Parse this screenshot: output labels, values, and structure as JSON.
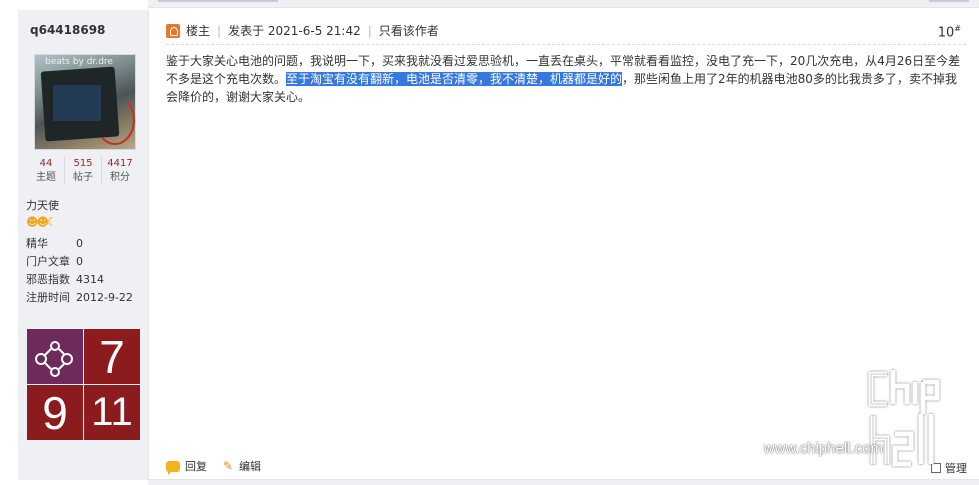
{
  "sidebar": {
    "username": "q64418698",
    "avatar_brand": "beats by dr.dre",
    "stats": [
      {
        "num": "44",
        "label": "主题"
      },
      {
        "num": "515",
        "label": "帖子"
      },
      {
        "num": "4417",
        "label": "积分"
      }
    ],
    "rank": "力天使",
    "star_icons": [
      "sun-icon",
      "sun-icon",
      "moon-icon"
    ],
    "info": [
      {
        "key": "精华",
        "value": "0"
      },
      {
        "key": "门户文章",
        "value": "0"
      },
      {
        "key": "邪恶指数",
        "value": "4314"
      },
      {
        "key": "注册时间",
        "value": "2012-9-22"
      }
    ],
    "medals": [
      "",
      "7",
      "9",
      "11"
    ]
  },
  "post": {
    "author_role": "楼主",
    "posted_at": "发表于 2021-6-5 21:42",
    "only_author": "只看该作者",
    "floor": "10",
    "floor_suffix": "#",
    "content_before": "鉴于大家关心电池的问题，我说明一下，买来我就没看过爱思验机，一直丢在桌头，平常就看看监控，没电了充一下，20几次充电，从4月26日至今差不多是这个充电次数。",
    "content_highlight": "至于淘宝有没有翻新，电池是否清零，我不清楚，机器都是好的",
    "content_after": "，那些闲鱼上用了2年的机器电池80多的比我贵多了，卖不掉我会降价的，谢谢大家关心。",
    "reply_label": "回复",
    "edit_label": "编辑",
    "checkbox_label": "管理"
  },
  "watermark": {
    "url": "www.chiphell.com"
  }
}
